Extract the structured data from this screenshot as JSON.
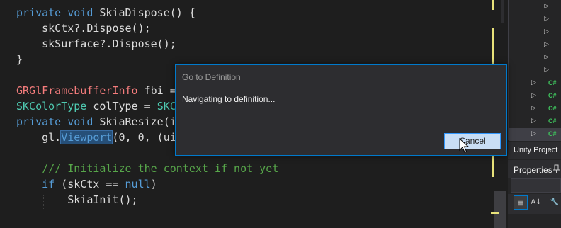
{
  "editor": {
    "lines": [
      {
        "parts": [
          {
            "t": "private",
            "c": "kw"
          },
          {
            "t": " "
          },
          {
            "t": "void",
            "c": "kw"
          },
          {
            "t": " SkiaDispose() {"
          }
        ]
      },
      {
        "parts": [
          {
            "t": "    skCtx?.Dispose();"
          }
        ]
      },
      {
        "parts": [
          {
            "t": "    skSurface?.Dispose();"
          }
        ]
      },
      {
        "parts": [
          {
            "t": "}"
          }
        ]
      },
      {
        "parts": []
      },
      {
        "parts": [
          {
            "t": "GRGlFramebufferInfo",
            "c": "ty-red"
          },
          {
            "t": " fbi = "
          }
        ]
      },
      {
        "parts": [
          {
            "t": "SKColorType",
            "c": "ty-green"
          },
          {
            "t": " colType = "
          },
          {
            "t": "SKC",
            "c": "ty-green"
          }
        ]
      },
      {
        "parts": [
          {
            "t": "private",
            "c": "kw"
          },
          {
            "t": " "
          },
          {
            "t": "void",
            "c": "kw"
          },
          {
            "t": " SkiaResize(i"
          }
        ]
      },
      {
        "parts": [
          {
            "t": "    gl."
          },
          {
            "t": "Viewport",
            "c": "sel"
          },
          {
            "t": "(0, 0, (ui"
          }
        ]
      },
      {
        "parts": []
      },
      {
        "parts": [
          {
            "t": "    /// Initialize the context if not yet",
            "c": "cm"
          }
        ]
      },
      {
        "parts": [
          {
            "t": "    "
          },
          {
            "t": "if",
            "c": "kw"
          },
          {
            "t": " (skCtx == "
          },
          {
            "t": "null",
            "c": "kw"
          },
          {
            "t": ")"
          }
        ]
      },
      {
        "parts": [
          {
            "t": "        SkiaInit();"
          }
        ]
      }
    ]
  },
  "dialog": {
    "title": "Go to Definition",
    "message": "Navigating to definition...",
    "cancel_label": "Cancel"
  },
  "right_panel": {
    "tree_badge": "C#",
    "tab_label": "Unity Project",
    "properties_title": "Properties",
    "pin_icon": "pin-icon",
    "toolbar_icons": [
      "categorized-icon",
      "alphabetical-icon",
      "wrench-icon"
    ],
    "toolbar_glyphs": [
      "▤",
      "A↓",
      "🔧"
    ]
  },
  "colors": {
    "accent": "#007acc",
    "change_marker": "#e8e27a",
    "csharp_badge": "#3ec15c"
  }
}
